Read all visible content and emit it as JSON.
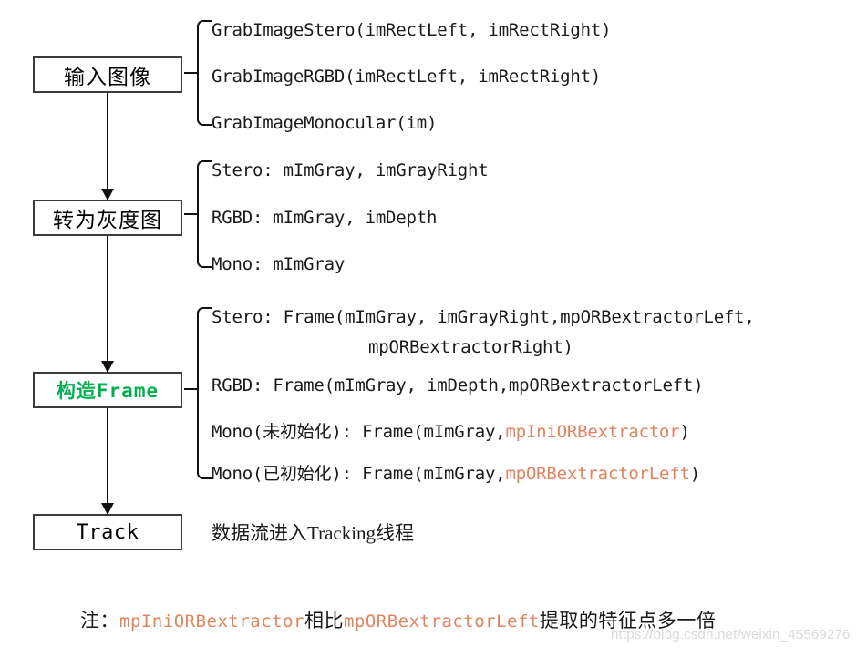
{
  "diagram": {
    "title": "ORB-SLAM2 image input to Tracking data flow",
    "nodes": [
      {
        "id": "input",
        "label": "输入图像",
        "color": "#1a1a1a"
      },
      {
        "id": "gray",
        "label": "转为灰度图",
        "color": "#1a1a1a"
      },
      {
        "id": "frame",
        "label": "构造Frame",
        "color": "#00b050"
      },
      {
        "id": "track",
        "label": "Track",
        "color": "#1a1a1a"
      }
    ],
    "groups": [
      {
        "id": "grab-image",
        "lines": [
          "GrabImageStero(imRectLeft, imRectRight)",
          "GrabImageRGBD(imRectLeft, imRectRight)",
          "GrabImageMonocular(im)"
        ]
      },
      {
        "id": "gray-output",
        "lines": [
          "Stero: mImGray, imGrayRight",
          "RGBD: mImGray, imDepth",
          "Mono: mImGray"
        ]
      },
      {
        "id": "frame-construct",
        "line_stero": "Stero: Frame(mImGray, imGrayRight,mpORBextractorLeft,",
        "line_stero_cont": "mpORBextractorRight)",
        "line_rgbd": "RGBD: Frame(mImGray, imDepth,mpORBextractorLeft)",
        "line_mono_uninit_pre": "Mono(未初始化): Frame(mImGray,",
        "line_mono_uninit_code": "mpIniORBextractor",
        "line_mono_uninit_post": ")",
        "line_mono_init_pre": "Mono(已初始化): Frame(mImGray,",
        "line_mono_init_code": "mpORBextractorLeft",
        "line_mono_init_post": ")"
      }
    ],
    "track_note": "数据流进入Tracking线程",
    "footnote": {
      "prefix": "注：",
      "code1": "mpIniORBextractor",
      "middle": "相比",
      "code2": "mpORBextractorLeft",
      "suffix": "提取的特征点多一倍"
    },
    "watermark": "https://blog.csdn.net/weixin_45569276",
    "colors": {
      "orange_code": "#e0845f",
      "green_node": "#00b050",
      "line": "#111111",
      "box_border": "#3c3c3c"
    }
  }
}
